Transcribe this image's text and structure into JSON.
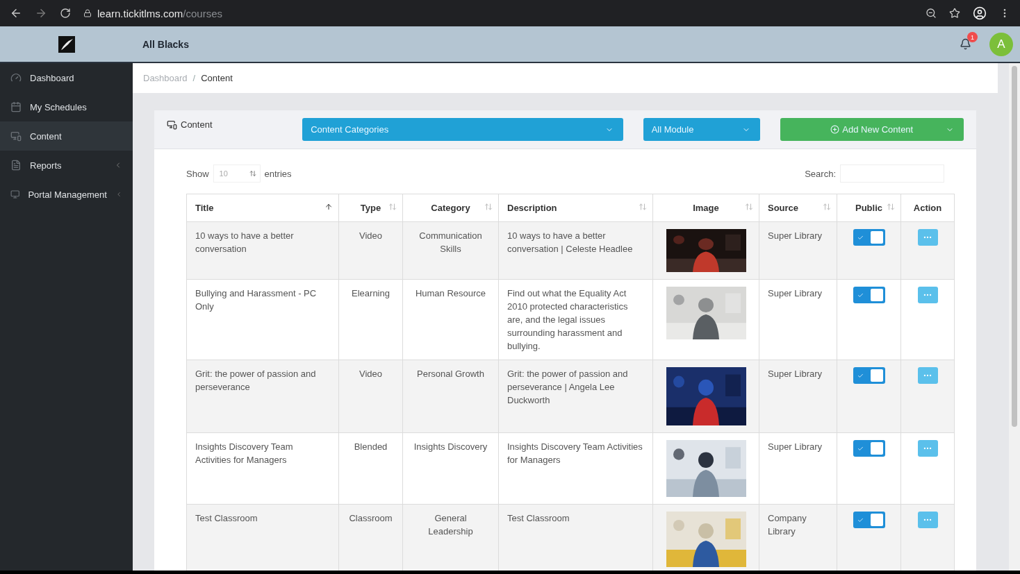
{
  "browser": {
    "url_host": "learn.tickitlms.com",
    "url_path": "/courses"
  },
  "header": {
    "org_name": "All Blacks",
    "notification_count": "1",
    "avatar_letter": "A"
  },
  "sidebar": {
    "items": [
      {
        "label": "Dashboard",
        "selected": false,
        "has_submenu": false
      },
      {
        "label": "My Schedules",
        "selected": false,
        "has_submenu": false
      },
      {
        "label": "Content",
        "selected": true,
        "has_submenu": false
      },
      {
        "label": "Reports",
        "selected": false,
        "has_submenu": true
      },
      {
        "label": "Portal Management",
        "selected": false,
        "has_submenu": true
      }
    ]
  },
  "breadcrumb": {
    "separator": "/",
    "items": [
      {
        "label": "Dashboard",
        "current": false
      },
      {
        "label": "Content",
        "current": true
      }
    ]
  },
  "card": {
    "title": "Content",
    "category_select": "Content Categories",
    "module_select": "All Module",
    "add_button": "Add New Content"
  },
  "table_controls": {
    "show_label": "Show",
    "page_size": "10",
    "entries_label": "entries",
    "search_label": "Search:"
  },
  "table": {
    "columns": [
      {
        "label": "Title",
        "sortable": true,
        "sorted": true
      },
      {
        "label": "Type",
        "sortable": true,
        "sorted": false
      },
      {
        "label": "Category",
        "sortable": true,
        "sorted": false
      },
      {
        "label": "Description",
        "sortable": true,
        "sorted": false
      },
      {
        "label": "Image",
        "sortable": true,
        "sorted": false
      },
      {
        "label": "Source",
        "sortable": true,
        "sorted": false
      },
      {
        "label": "Public",
        "sortable": true,
        "sorted": false
      },
      {
        "label": "Action",
        "sortable": false
      }
    ],
    "rows": [
      {
        "title": "10 ways to have a better conversation",
        "type": "Video",
        "category": "Communication Skills",
        "description": "10 ways to have a better conversation | Celeste Headlee",
        "source": "Super Library",
        "public": true
      },
      {
        "title": "Bullying and Harassment - PC Only",
        "type": "Elearning",
        "category": "Human Resource",
        "description": "Find out what the Equality Act 2010 protected characteristics are, and the legal issues surrounding harassment and bullying.",
        "source": "Super Library",
        "public": true
      },
      {
        "title": "Grit: the power of passion and perseverance",
        "type": "Video",
        "category": "Personal Growth",
        "description": "Grit: the power of passion and perseverance | Angela Lee Duckworth",
        "source": "Super Library",
        "public": true
      },
      {
        "title": "Insights Discovery Team Activities for Managers",
        "type": "Blended",
        "category": "Insights Discovery",
        "description": "Insights Discovery Team Activities for Managers",
        "source": "Super Library",
        "public": true
      },
      {
        "title": "Test Classroom",
        "type": "Classroom",
        "category": "General Leadership",
        "description": "Test Classroom",
        "source": "Company Library",
        "public": true
      }
    ]
  }
}
